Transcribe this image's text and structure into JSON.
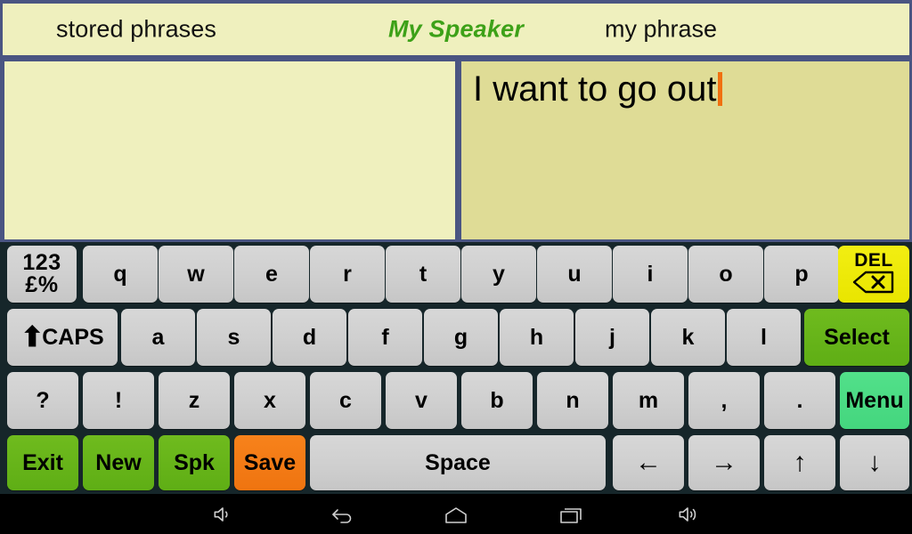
{
  "titlebar": {
    "left_label": "stored phrases",
    "app_title": "My Speaker",
    "right_label": "my phrase",
    "bg_color": "#eff0be",
    "border_color": "#4a5582",
    "title_color": "#3da118"
  },
  "panels": {
    "stored_phrases": {
      "text": "",
      "bg_color": "#eff0be"
    },
    "my_phrase": {
      "text": "I want to go out",
      "bg_color": "#dfdc96",
      "caret_color": "#f07010"
    }
  },
  "keyboard": {
    "bg_color": "#16262a",
    "key_color": "#d0d0d0",
    "row1": [
      {
        "name": "numeric-mode-key",
        "line1": "123",
        "line2": "£%",
        "style": "normal"
      },
      {
        "name": "key-q",
        "label": "q",
        "style": "normal"
      },
      {
        "name": "key-w",
        "label": "w",
        "style": "normal"
      },
      {
        "name": "key-e",
        "label": "e",
        "style": "normal"
      },
      {
        "name": "key-r",
        "label": "r",
        "style": "normal"
      },
      {
        "name": "key-t",
        "label": "t",
        "style": "normal"
      },
      {
        "name": "key-y",
        "label": "y",
        "style": "normal"
      },
      {
        "name": "key-u",
        "label": "u",
        "style": "normal"
      },
      {
        "name": "key-i",
        "label": "i",
        "style": "normal"
      },
      {
        "name": "key-o",
        "label": "o",
        "style": "normal"
      },
      {
        "name": "key-p",
        "label": "p",
        "style": "normal"
      },
      {
        "name": "delete-key",
        "label": "DEL",
        "style": "yellow"
      }
    ],
    "row2": [
      {
        "name": "caps-key",
        "label": "CAPS",
        "style": "normal"
      },
      {
        "name": "key-a",
        "label": "a",
        "style": "normal"
      },
      {
        "name": "key-s",
        "label": "s",
        "style": "normal"
      },
      {
        "name": "key-d",
        "label": "d",
        "style": "normal"
      },
      {
        "name": "key-f",
        "label": "f",
        "style": "normal"
      },
      {
        "name": "key-g",
        "label": "g",
        "style": "normal"
      },
      {
        "name": "key-h",
        "label": "h",
        "style": "normal"
      },
      {
        "name": "key-j",
        "label": "j",
        "style": "normal"
      },
      {
        "name": "key-k",
        "label": "k",
        "style": "normal"
      },
      {
        "name": "key-l",
        "label": "l",
        "style": "normal"
      },
      {
        "name": "select-key",
        "label": "Select",
        "style": "green"
      }
    ],
    "row3": [
      {
        "name": "key-question",
        "label": "?",
        "style": "normal"
      },
      {
        "name": "key-exclamation",
        "label": "!",
        "style": "normal"
      },
      {
        "name": "key-z",
        "label": "z",
        "style": "normal"
      },
      {
        "name": "key-x",
        "label": "x",
        "style": "normal"
      },
      {
        "name": "key-c",
        "label": "c",
        "style": "normal"
      },
      {
        "name": "key-v",
        "label": "v",
        "style": "normal"
      },
      {
        "name": "key-b",
        "label": "b",
        "style": "normal"
      },
      {
        "name": "key-n",
        "label": "n",
        "style": "normal"
      },
      {
        "name": "key-m",
        "label": "m",
        "style": "normal"
      },
      {
        "name": "key-comma",
        "label": ",",
        "style": "normal"
      },
      {
        "name": "key-period",
        "label": ".",
        "style": "normal"
      },
      {
        "name": "menu-key",
        "label": "Menu",
        "style": "mint"
      }
    ],
    "row4": [
      {
        "name": "exit-key",
        "label": "Exit",
        "style": "green"
      },
      {
        "name": "new-key",
        "label": "New",
        "style": "green"
      },
      {
        "name": "speak-key",
        "label": "Spk",
        "style": "green"
      },
      {
        "name": "save-key",
        "label": "Save",
        "style": "orange"
      },
      {
        "name": "space-key",
        "label": "Space",
        "style": "normal"
      },
      {
        "name": "arrow-left-key",
        "label": "←",
        "style": "normal"
      },
      {
        "name": "arrow-right-key",
        "label": "→",
        "style": "normal"
      },
      {
        "name": "arrow-up-key",
        "label": "↑",
        "style": "normal"
      },
      {
        "name": "arrow-down-key",
        "label": "↓",
        "style": "normal"
      }
    ]
  },
  "navbar": {
    "bg_color": "#000000",
    "items": [
      {
        "name": "volume-down-icon"
      },
      {
        "name": "back-icon"
      },
      {
        "name": "home-icon"
      },
      {
        "name": "recents-icon"
      },
      {
        "name": "volume-up-icon"
      }
    ]
  }
}
